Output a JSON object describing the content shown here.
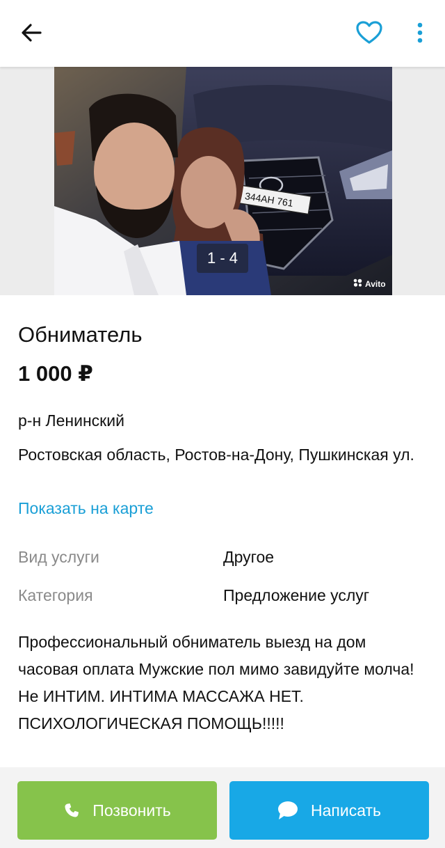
{
  "header": {
    "back_icon": "arrow-left-icon",
    "favorite_icon": "heart-outline-icon",
    "more_icon": "vertical-dots-icon",
    "accent_color": "#1a9fd6"
  },
  "gallery": {
    "counter": "1 - 4",
    "plate_text": "344AH 761",
    "watermark": "Avito"
  },
  "listing": {
    "title": "Обниматель",
    "price": "1 000 ₽",
    "district": "р-н Ленинский",
    "address": "Ростовская область, Ростов-на-Дону, Пушкинская ул.",
    "map_link": "Показать на карте"
  },
  "params": [
    {
      "label": "Вид услуги",
      "value": "Другое"
    },
    {
      "label": "Категория",
      "value": "Предложение услуг"
    }
  ],
  "description": "Профессиональный обниматель выезд на дом часовая оплата Мужские пол мимо завидуйте молча! Не ИНТИМ. ИНТИМА МАССАЖА НЕТ. ПСИХОЛОГИЧЕСКАЯ ПОМОЩЬ!!!!!",
  "actions": {
    "call_label": "Позвонить",
    "call_icon": "phone-icon",
    "call_color": "#86c34b",
    "write_label": "Написать",
    "write_icon": "chat-bubble-icon",
    "write_color": "#18a8e6"
  }
}
